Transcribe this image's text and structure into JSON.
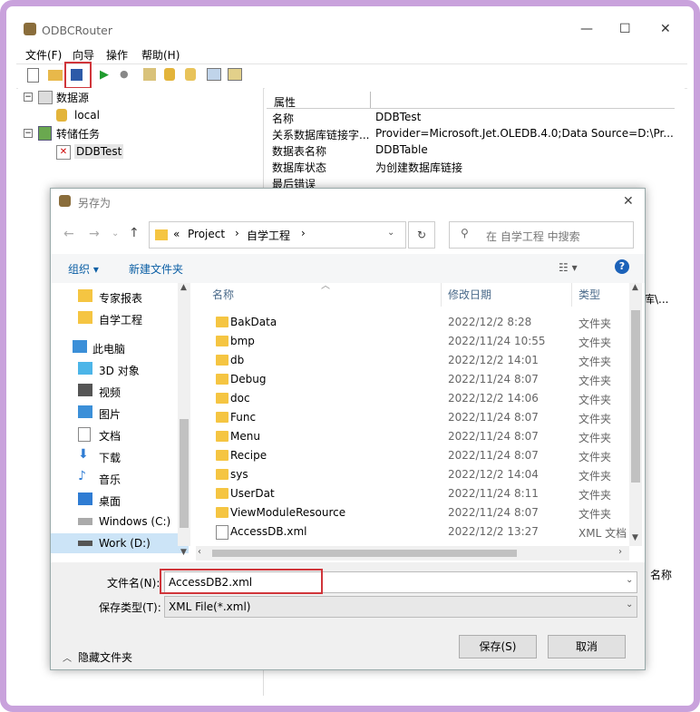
{
  "app": {
    "title": "ODBCRouter",
    "menu": [
      "文件(F)",
      "向导",
      "操作",
      "帮助(H)"
    ],
    "window_controls": [
      "—",
      "☐",
      "✕"
    ]
  },
  "tree": {
    "datasource_label": "数据源",
    "datasource_child": "local",
    "task_label": "转储任务",
    "task_child": "DDBTest"
  },
  "props": {
    "header": "属性",
    "rows": [
      {
        "k": "名称",
        "v": "DDBTest"
      },
      {
        "k": "关系数据库链接字...",
        "v": "Provider=Microsoft.Jet.OLEDB.4.0;Data Source=D:\\Pr..."
      },
      {
        "k": "数据表名称",
        "v": "DDBTable"
      },
      {
        "k": "数据库状态",
        "v": "为创建数据库链接"
      },
      {
        "k": "最后错误",
        "v": ""
      }
    ],
    "tail_fragment": "库\\...",
    "name_col": "名称"
  },
  "dialog": {
    "title": "另存为",
    "close": "✕",
    "breadcrumb": [
      "«",
      "Project",
      "›",
      "自学工程",
      "›"
    ],
    "search_placeholder": "在 自学工程 中搜索",
    "organize": "组织 ▾",
    "new_folder": "新建文件夹",
    "help": "?",
    "nav": [
      {
        "label": "专家报表",
        "color": "#f5c542"
      },
      {
        "label": "自学工程",
        "color": "#f5c542"
      },
      {
        "label": "此电脑",
        "color": "#3b8fd8"
      },
      {
        "label": "3D 对象",
        "color": "#4cb5e8"
      },
      {
        "label": "视频",
        "color": "#555555"
      },
      {
        "label": "图片",
        "color": "#3b8fd8"
      },
      {
        "label": "文档",
        "color": "#888888"
      },
      {
        "label": "下载",
        "color": "#2f7cd3"
      },
      {
        "label": "音乐",
        "color": "#2f7cd3"
      },
      {
        "label": "桌面",
        "color": "#2f7cd3"
      },
      {
        "label": "Windows (C:)",
        "color": "#666666"
      },
      {
        "label": "Work (D:)",
        "color": "#555555"
      }
    ],
    "columns": {
      "name": "名称",
      "date": "修改日期",
      "type": "类型"
    },
    "files": [
      {
        "name": "BakData",
        "date": "2022/12/2 8:28",
        "type": "文件夹"
      },
      {
        "name": "bmp",
        "date": "2022/11/24 10:55",
        "type": "文件夹"
      },
      {
        "name": "db",
        "date": "2022/12/2 14:01",
        "type": "文件夹"
      },
      {
        "name": "Debug",
        "date": "2022/11/24 8:07",
        "type": "文件夹"
      },
      {
        "name": "doc",
        "date": "2022/12/2 14:06",
        "type": "文件夹"
      },
      {
        "name": "Func",
        "date": "2022/11/24 8:07",
        "type": "文件夹"
      },
      {
        "name": "Menu",
        "date": "2022/11/24 8:07",
        "type": "文件夹"
      },
      {
        "name": "Recipe",
        "date": "2022/11/24 8:07",
        "type": "文件夹"
      },
      {
        "name": "sys",
        "date": "2022/12/2 14:04",
        "type": "文件夹"
      },
      {
        "name": "UserDat",
        "date": "2022/11/24 8:11",
        "type": "文件夹"
      },
      {
        "name": "ViewModuleResource",
        "date": "2022/11/24 8:07",
        "type": "文件夹"
      },
      {
        "name": "AccessDB.xml",
        "date": "2022/12/2 13:27",
        "type": "XML 文档"
      }
    ],
    "filename_label": "文件名(N):",
    "filename_value": "AccessDB2.xml",
    "filetype_label": "保存类型(T):",
    "filetype_value": "XML File(*.xml)",
    "hide_folders": "隐藏文件夹",
    "save": "保存(S)",
    "cancel": "取消"
  },
  "colors": {
    "highlight": "#d0353a",
    "frame": "#c9a2dc",
    "link": "#0b5fa5"
  }
}
